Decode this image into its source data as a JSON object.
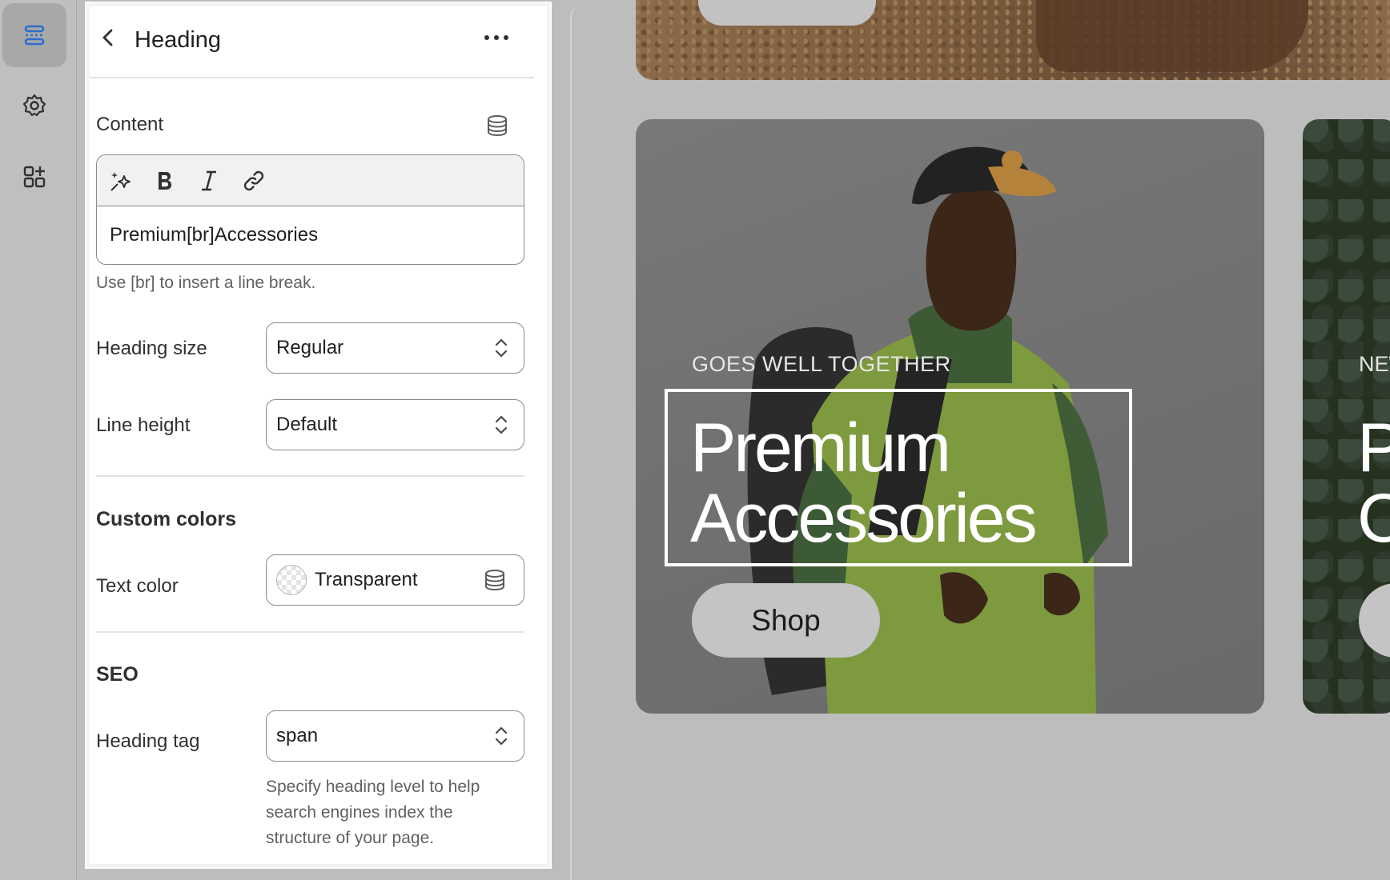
{
  "rail": {
    "items": [
      {
        "name": "sections",
        "icon": "sections-icon",
        "active": true
      },
      {
        "name": "settings",
        "icon": "gear-icon"
      },
      {
        "name": "apps",
        "icon": "apps-add-icon"
      }
    ]
  },
  "panel": {
    "title": "Heading",
    "content_label": "Content",
    "editor_value": "Premium[br]Accessories",
    "editor_hint": "Use [br] to insert a line break.",
    "heading_size_label": "Heading size",
    "heading_size_value": "Regular",
    "line_height_label": "Line height",
    "line_height_value": "Default",
    "custom_colors_title": "Custom colors",
    "text_color_label": "Text color",
    "text_color_value": "Transparent",
    "seo_title": "SEO",
    "heading_tag_label": "Heading tag",
    "heading_tag_value": "span",
    "heading_tag_hint_1": "Specify heading level to help",
    "heading_tag_hint_2": "search engines index the",
    "heading_tag_hint_3": "structure of your page."
  },
  "preview": {
    "card1": {
      "eyebrow": "GOES WELL TOGETHER",
      "heading_line1": "Premium",
      "heading_line2": "Accessories",
      "button": "Shop"
    },
    "card2": {
      "eyebrow": "NEW",
      "heading_line1": "P",
      "heading_line2": "C"
    }
  },
  "colors": {
    "accent": "#2c6ecb",
    "panel_bg": "#ffffff",
    "canvas_bg": "#bdbdbd"
  }
}
